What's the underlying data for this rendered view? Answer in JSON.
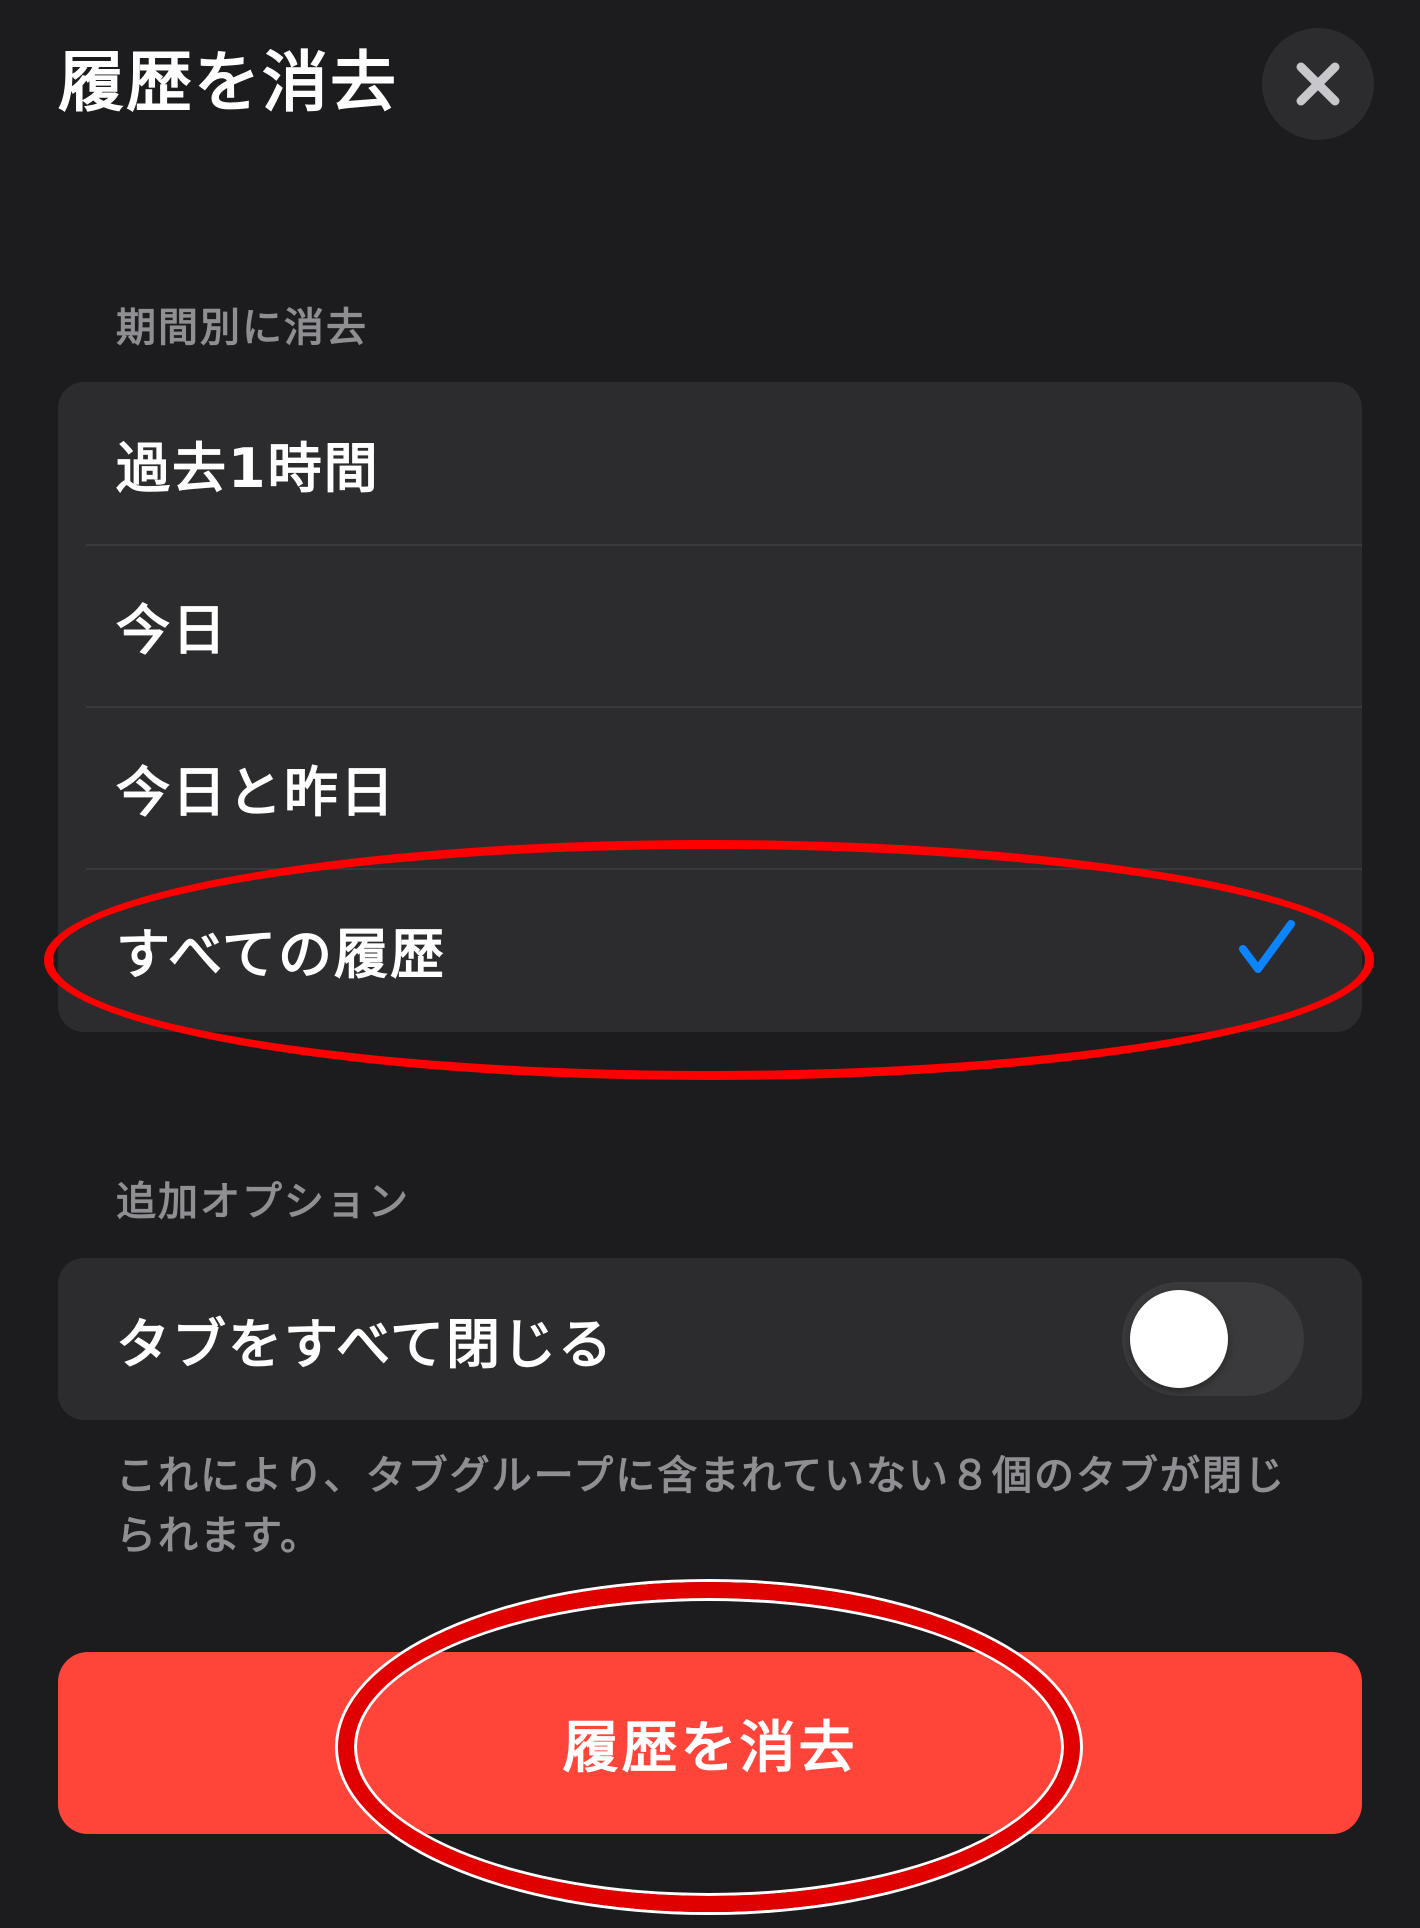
{
  "header": {
    "title": "履歴を消去",
    "close_icon": "close-icon"
  },
  "period_section": {
    "header": "期間別に消去",
    "options": [
      {
        "label": "過去1時間",
        "selected": false
      },
      {
        "label": "今日",
        "selected": false
      },
      {
        "label": "今日と昨日",
        "selected": false
      },
      {
        "label": "すべての履歴",
        "selected": true
      }
    ],
    "check_icon": "checkmark-icon"
  },
  "options_section": {
    "header": "追加オプション",
    "close_tabs_label": "タブをすべて閉じる",
    "close_tabs_enabled": false,
    "footnote": "これにより、タブグループに含まれていない８個のタブが閉じられます。"
  },
  "actions": {
    "clear_button_label": "履歴を消去"
  },
  "colors": {
    "background": "#1c1c1e",
    "group": "#2c2c2e",
    "secondary_text": "#8e8e93",
    "accent_blue": "#0a84ff",
    "destructive_red": "#ff453a",
    "annotation_red": "#ff0000"
  }
}
